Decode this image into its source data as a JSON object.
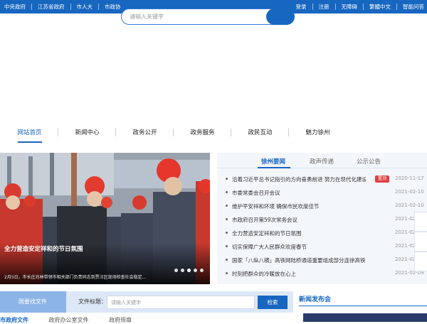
{
  "topbar": {
    "left_links": [
      "中央政府",
      "江苏省政府",
      "市人大",
      "市政协"
    ],
    "right_links": [
      "登录",
      "注册",
      "无障碍",
      "繁體中文",
      "智能问答"
    ]
  },
  "search": {
    "placeholder": "请输入关键字"
  },
  "nav": [
    "网站首页",
    "新闻中心",
    "政务公开",
    "政务服务",
    "政民互动",
    "魅力徐州"
  ],
  "nav_active": "网站首页",
  "hero": {
    "title": "全力营造安定祥和的节日氛围",
    "desc": "2月5日，市长庄兆林带领市相关部门负责同志到贾汪区现场检查社会稳定...",
    "slides": 5,
    "active_slide": 4
  },
  "news_tabs": [
    "徐州要闻",
    "政声传递",
    "公示公告"
  ],
  "news_active_tab": "徐州要闻",
  "news": [
    {
      "text": "沿着习近平总书记指引的方向奋勇前进 努力在现代化建设...",
      "badge": "置顶",
      "date": "2020-11-17"
    },
    {
      "text": "市委常委会召开会议",
      "badge": "",
      "date": "2021-02-10"
    },
    {
      "text": "维护平安祥和环境 确保市民欢度佳节",
      "badge": "",
      "date": "2021-02-10"
    },
    {
      "text": "市政府召开第59次常务会议",
      "badge": "",
      "date": "2021-02-10"
    },
    {
      "text": "全力营造安定祥和的节日氛围",
      "badge": "",
      "date": "2021-02-10"
    },
    {
      "text": "切实保障广大人民群众欢度春节",
      "badge": "",
      "date": "2021-02-10"
    },
    {
      "text": "国家「八纵八横」高铁网陆桥通道重要组成部分连徐高铁...",
      "badge": "",
      "date": "2021-02-10"
    },
    {
      "text": "时刻把群众的冷暖放在心上",
      "badge": "",
      "date": "2021-02-09"
    }
  ],
  "filebar": {
    "label": "国要找文件",
    "field_label": "文件标题：",
    "placeholder": "请输入关键字",
    "button": "检索"
  },
  "press": {
    "title": "新闻发布会"
  },
  "bottom_tabs": [
    "市政府文件",
    "政府办公室文件",
    "政府规章"
  ],
  "colors": {
    "primary": "#1766c0",
    "badge": "#e04040",
    "panel_bg": "#f3f6fb"
  }
}
